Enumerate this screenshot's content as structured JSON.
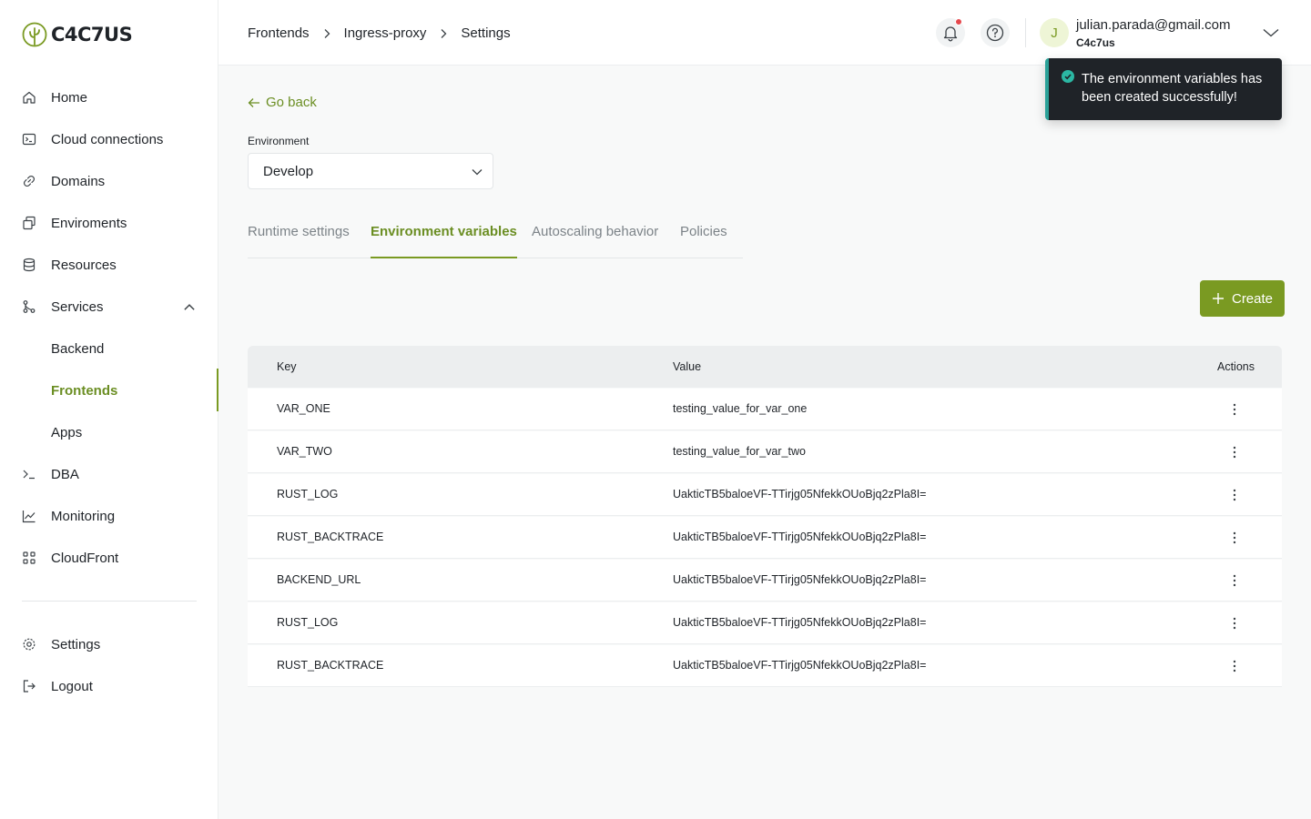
{
  "brand": {
    "name": "C4C7US"
  },
  "sidebar": {
    "items": [
      {
        "label": "Home",
        "icon": "home-icon"
      },
      {
        "label": "Cloud connections",
        "icon": "terminal-icon"
      },
      {
        "label": "Domains",
        "icon": "link-icon"
      },
      {
        "label": "Enviroments",
        "icon": "layers-icon"
      },
      {
        "label": "Resources",
        "icon": "database-icon"
      },
      {
        "label": "Services",
        "icon": "git-branch-icon"
      },
      {
        "label": "DBA",
        "icon": "prompt-icon"
      },
      {
        "label": "Monitoring",
        "icon": "chart-icon"
      },
      {
        "label": "CloudFront",
        "icon": "grid-icon"
      }
    ],
    "services_sub": [
      "Backend",
      "Frontends",
      "Apps"
    ],
    "active_sub": "Frontends",
    "bottom": [
      {
        "label": "Settings",
        "icon": "gear-icon"
      },
      {
        "label": "Logout",
        "icon": "logout-icon"
      }
    ]
  },
  "header": {
    "breadcrumb": [
      "Frontends",
      "Ingress-proxy",
      "Settings"
    ],
    "user": {
      "initial": "J",
      "email": "julian.parada@gmail.com",
      "org": "C4c7us"
    }
  },
  "toast": {
    "message": "The environment variables has been created successfully!"
  },
  "main": {
    "go_back": "Go back",
    "environment_label": "Environment",
    "environment_value": "Develop",
    "tabs": [
      "Runtime settings",
      "Environment variables",
      "Autoscaling behavior",
      "Policies"
    ],
    "active_tab": "Environment variables",
    "create_label": "Create"
  },
  "table": {
    "columns": {
      "key": "Key",
      "value": "Value",
      "actions": "Actions"
    },
    "rows": [
      {
        "key": "VAR_ONE",
        "value": "testing_value_for_var_one"
      },
      {
        "key": "VAR_TWO",
        "value": "testing_value_for_var_two"
      },
      {
        "key": "RUST_LOG",
        "value": "UakticTB5baloeVF-TTirjg05NfekkOUoBjq2zPla8I="
      },
      {
        "key": "RUST_BACKTRACE",
        "value": "UakticTB5baloeVF-TTirjg05NfekkOUoBjq2zPla8I="
      },
      {
        "key": "BACKEND_URL",
        "value": "UakticTB5baloeVF-TTirjg05NfekkOUoBjq2zPla8I="
      },
      {
        "key": "RUST_LOG",
        "value": "UakticTB5baloeVF-TTirjg05NfekkOUoBjq2zPla8I="
      },
      {
        "key": "RUST_BACKTRACE",
        "value": "UakticTB5baloeVF-TTirjg05NfekkOUoBjq2zPla8I="
      }
    ]
  },
  "colors": {
    "accent": "#7a9a22",
    "accent_text": "#6b8e23",
    "toast_bg": "#1f2328",
    "toast_success": "#2bb7a3",
    "notification_dot": "#e5484d"
  }
}
